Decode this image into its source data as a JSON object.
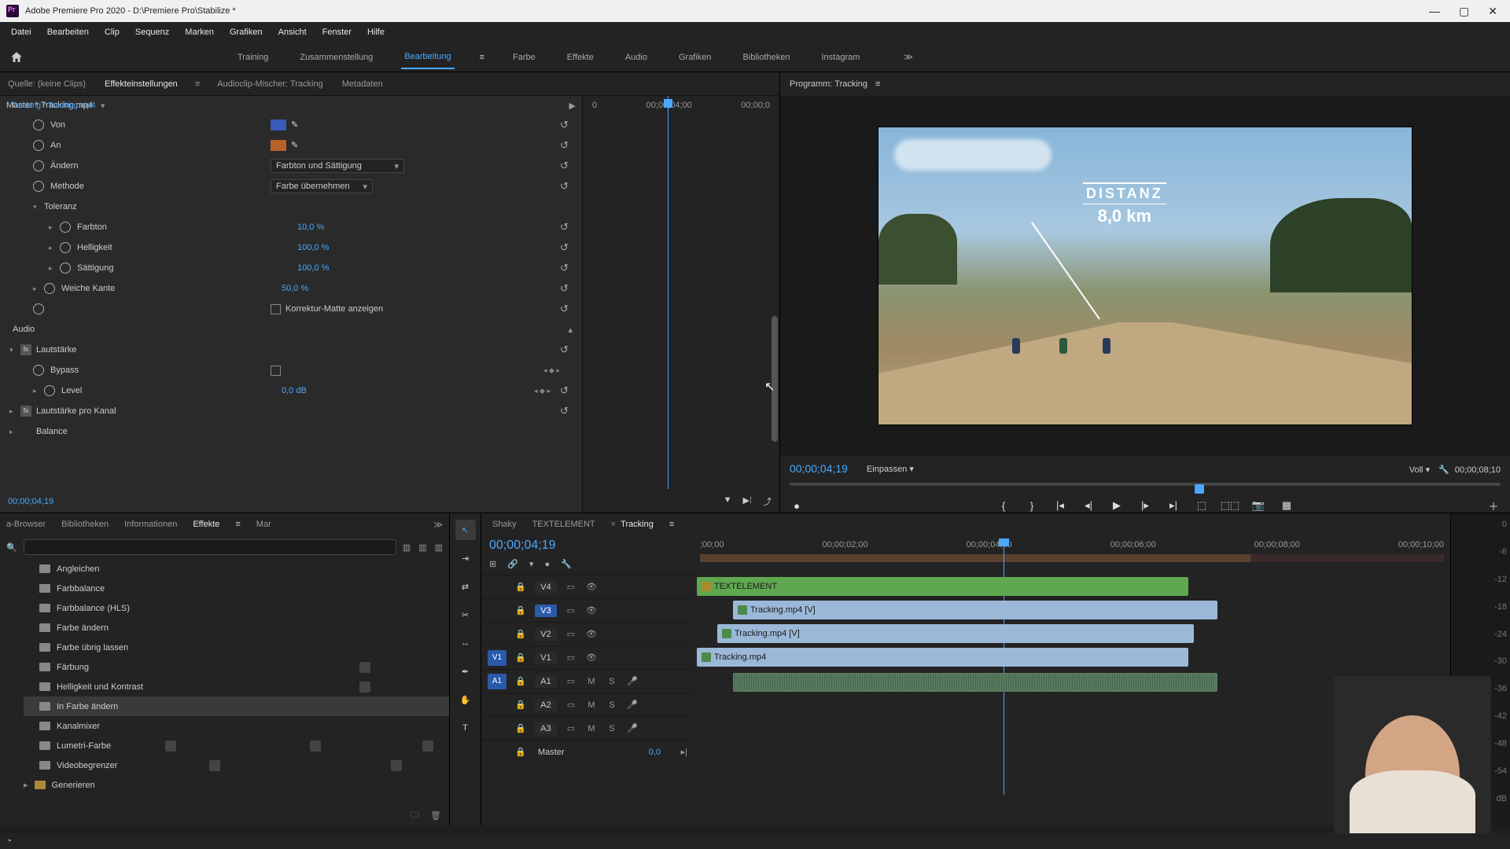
{
  "window": {
    "title": "Adobe Premiere Pro 2020 - D:\\Premiere Pro\\Stabilize *"
  },
  "menubar": [
    "Datei",
    "Bearbeiten",
    "Clip",
    "Sequenz",
    "Marken",
    "Grafiken",
    "Ansicht",
    "Fenster",
    "Hilfe"
  ],
  "workspaces": {
    "items": [
      "Training",
      "Zusammenstellung",
      "Bearbeitung",
      "Farbe",
      "Effekte",
      "Audio",
      "Grafiken",
      "Bibliotheken",
      "Instagram"
    ],
    "active": "Bearbeitung"
  },
  "source_tabs": {
    "source": "Quelle: (keine Clips)",
    "effects": "Effekteinstellungen",
    "mixer": "Audioclip-Mischer: Tracking",
    "meta": "Metadaten"
  },
  "effect_controls": {
    "master": "Master * Tracking.mp4",
    "clip": "Tracking * Tracking.mp4",
    "rows": {
      "von": "Von",
      "an": "An",
      "aendern": "Ändern",
      "aendern_val": "Farbton und Sättigung",
      "methode": "Methode",
      "methode_val": "Farbe übernehmen",
      "toleranz": "Toleranz",
      "farbton": "Farbton",
      "farbton_val": "10,0 %",
      "helligkeit": "Helligkeit",
      "helligkeit_val": "100,0 %",
      "saettigung": "Sättigung",
      "saettigung_val": "100,0 %",
      "weiche": "Weiche Kante",
      "weiche_val": "50,0 %",
      "matte": "Korrektur-Matte anzeigen",
      "audio": "Audio",
      "lautstaerke": "Lautstärke",
      "bypass": "Bypass",
      "level": "Level",
      "level_val": "0,0 dB",
      "kanal": "Lautstärke pro Kanal",
      "balance": "Balance"
    },
    "timeruler": {
      "t0": "0",
      "t1": "00;00;04;00",
      "t2": "00;00;0"
    },
    "timecode": "00;00;04;19"
  },
  "program": {
    "title": "Programm: Tracking",
    "overlay": {
      "label": "DISTANZ",
      "value": "8,0 km"
    },
    "timecode": "00;00;04;19",
    "fit": "Einpassen",
    "quality": "Voll",
    "duration": "00;00;08;10"
  },
  "project": {
    "tabs": [
      "a-Browser",
      "Bibliotheken",
      "Informationen",
      "Effekte",
      "Mar"
    ],
    "active": "Effekte",
    "items": [
      "Angleichen",
      "Farbbalance",
      "Farbbalance (HLS)",
      "Farbe ändern",
      "Farbe übrig lassen",
      "Färbung",
      "Helligkeit und Kontrast",
      "In Farbe ändern",
      "Kanalmixer",
      "Lumetri-Farbe",
      "Videobegrenzer",
      "Generieren"
    ],
    "selected": "In Farbe ändern"
  },
  "timeline": {
    "tabs": [
      "Shaky",
      "TEXTELEMENT",
      "Tracking"
    ],
    "active": "Tracking",
    "timecode": "00;00;04;19",
    "ruler": [
      ";00;00",
      "00;00;02;00",
      "00;00;04;00",
      "00;00;06;00",
      "00;00;08;00",
      "00;00;10;00"
    ],
    "tracks": {
      "v4": "V4",
      "v3": "V3",
      "v2": "V2",
      "v1": "V1",
      "a1": "A1",
      "a2": "A2",
      "a3": "A3",
      "master": "Master",
      "master_val": "0,0",
      "src_v1": "V1",
      "src_a1": "A1"
    },
    "clips": {
      "text": "TEXTELEMENT",
      "v3": "Tracking.mp4 [V]",
      "v2": "Tracking.mp4 [V]",
      "v1": "Tracking.mp4"
    },
    "mute": "M",
    "solo": "S"
  },
  "meter_scale": [
    "0",
    "-6",
    "-12",
    "-18",
    "-24",
    "-30",
    "-36",
    "-42",
    "-48",
    "-54",
    "dB"
  ]
}
